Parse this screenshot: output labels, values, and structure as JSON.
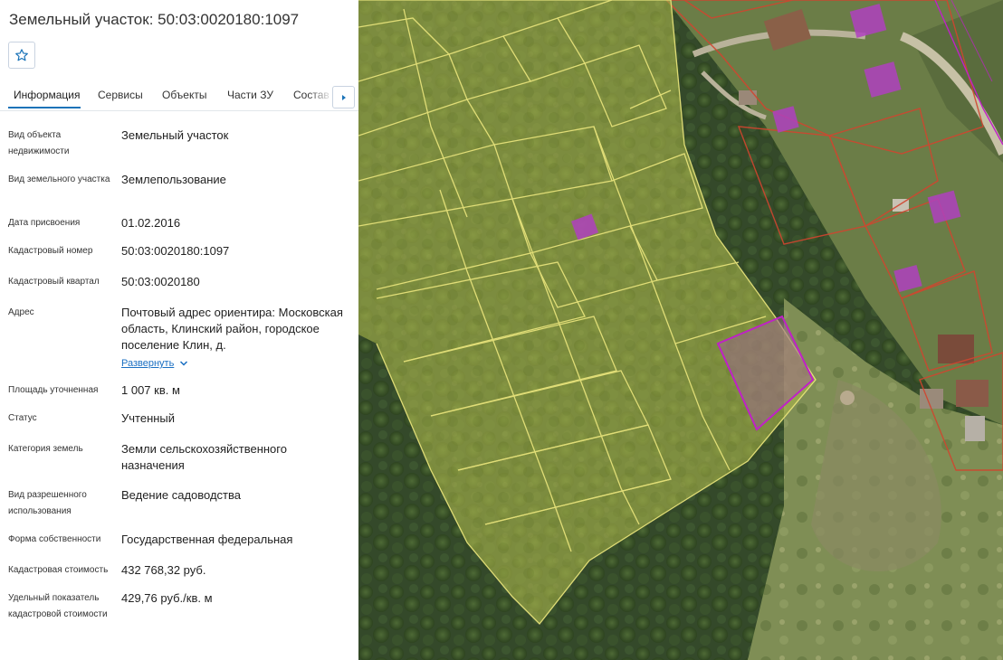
{
  "title": "Земельный участок: 50:03:0020180:1097",
  "tabs": [
    "Информация",
    "Сервисы",
    "Объекты",
    "Части ЗУ",
    "Состав ЕЗП"
  ],
  "fields": [
    {
      "label": "Вид объекта недвижимости",
      "value": "Земельный участок"
    },
    {
      "label": "Вид земельного участка",
      "value": "Землепользование"
    },
    {
      "label": "Дата присвоения",
      "value": "01.02.2016"
    },
    {
      "label": "Кадастровый номер",
      "value": "50:03:0020180:1097"
    },
    {
      "label": "Кадастровый квартал",
      "value": "50:03:0020180"
    },
    {
      "label": "Адрес",
      "value": "Почтовый адрес ориентира: Московская область, Клинский район, городское поселение Клин, д."
    },
    {
      "label": "Площадь уточненная",
      "value": "1 007 кв. м"
    },
    {
      "label": "Статус",
      "value": "Учтенный"
    },
    {
      "label": "Категория земель",
      "value": "Земли сельскохозяйственного назначения"
    },
    {
      "label": "Вид разрешенного использования",
      "value": "Ведение садоводства"
    },
    {
      "label": "Форма собственности",
      "value": "Государственная федеральная"
    },
    {
      "label": "Кадастровая стоимость",
      "value": "432 768,32 руб."
    },
    {
      "label": "Удельный показатель кадастровой стоимости",
      "value": "429,76 руб./кв. м"
    }
  ],
  "expand_label": "Развернуть",
  "icons": {
    "favorite": "star-outline-icon",
    "next": "caret-right-icon",
    "expand": "chevron-down-icon"
  },
  "colors": {
    "accent": "#1a73b8",
    "link": "#1a6fc2",
    "parcel_outline": "#e6e27a",
    "selected_parcel": "#c020c8",
    "building": "#b040c0"
  }
}
